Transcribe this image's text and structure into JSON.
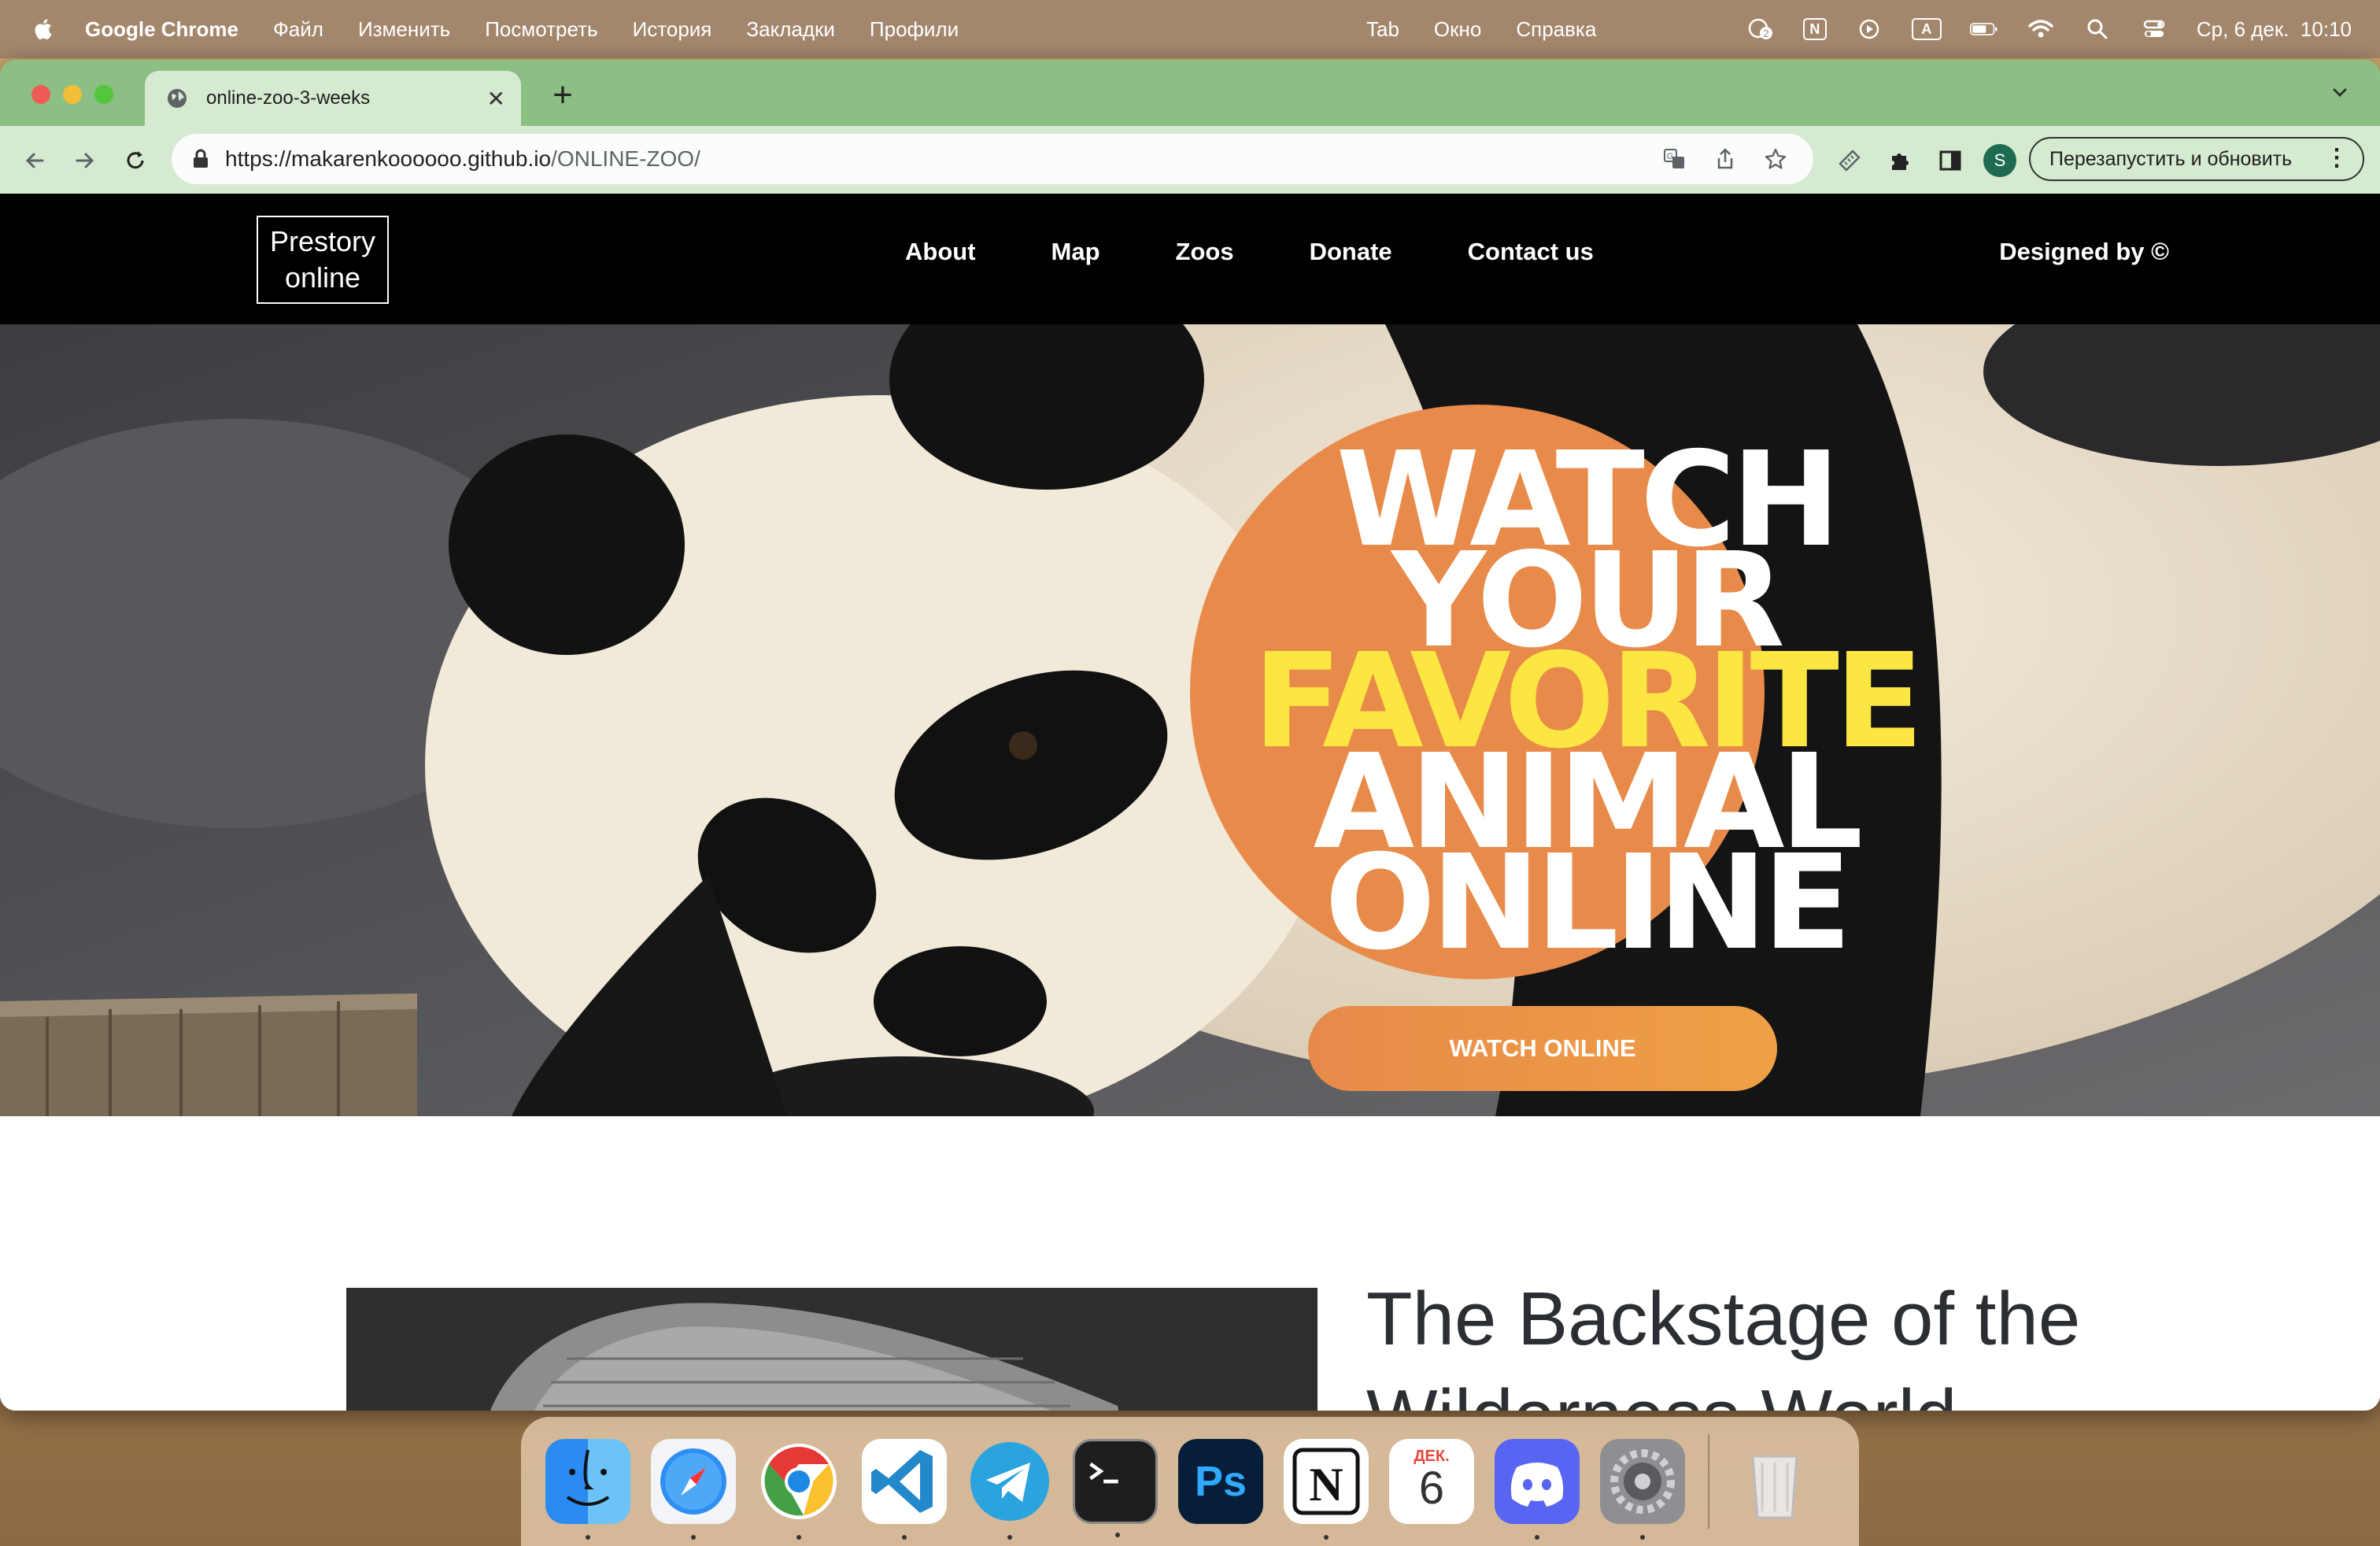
{
  "menubar": {
    "app_name": "Google Chrome",
    "items": [
      "Файл",
      "Изменить",
      "Посмотреть",
      "История",
      "Закладки",
      "Профили"
    ],
    "center_items": [
      "Tab",
      "Окно",
      "Справка"
    ],
    "notif_badge": "2",
    "input_source": "A",
    "notion_letter": "N",
    "datetime": "Ср, 6 дек.  10:10"
  },
  "browser": {
    "tab_title": "online-zoo-3-weeks",
    "url_host": "https://makarenkoooooo.github.io",
    "url_path": "/ONLINE-ZOO/",
    "profile_initial": "S",
    "relaunch_label": "Перезапустить и обновить"
  },
  "site": {
    "logo_line1": "Prestory",
    "logo_line2": "online",
    "nav": [
      "About",
      "Map",
      "Zoos",
      "Donate",
      "Contact us"
    ],
    "designed_by": "Designed by ©",
    "hero": {
      "line1": "WATCH",
      "line2": "YOUR",
      "line3": "FAVORITE",
      "line4": "ANIMAL",
      "line5": "ONLINE",
      "button": "WATCH ONLINE"
    },
    "section_title": "The Backstage of the Wilderness World"
  },
  "dock": {
    "calendar_month": "ДЕК.",
    "calendar_day": "6",
    "apps": [
      "finder",
      "safari",
      "chrome",
      "vscode",
      "telegram",
      "terminal",
      "photoshop",
      "notion",
      "calendar",
      "discord",
      "system-settings",
      "trash"
    ]
  },
  "colors": {
    "accent_orange": "#e88b4a",
    "highlight_yellow": "#fbe642",
    "tabstrip_green": "#8cbf83"
  }
}
